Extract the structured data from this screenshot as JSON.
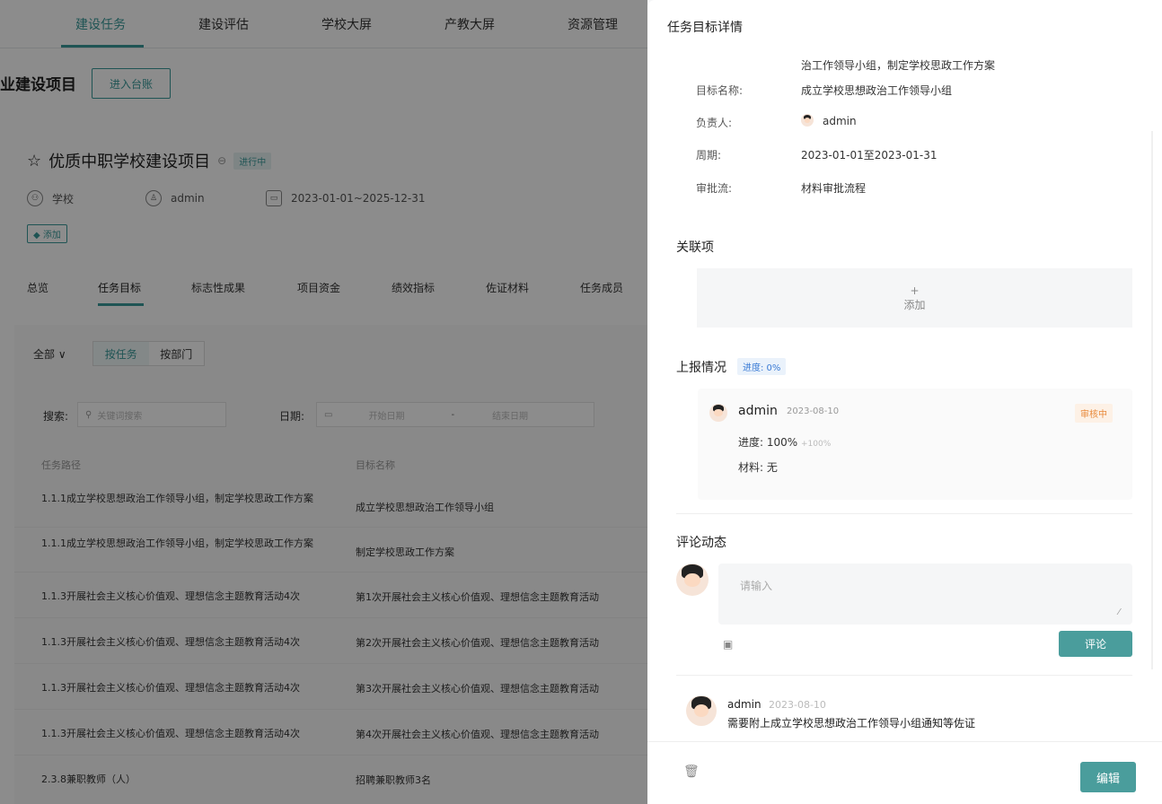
{
  "colors": {
    "accent": "#3a9a9a",
    "button": "#4a9d9c",
    "overlay": "rgba(0,0,0,0.45)",
    "warning": "#e8893a",
    "info": "#3a7bd5"
  },
  "topnav": {
    "items": [
      "建设任务",
      "建设评估",
      "学校大屏",
      "产教大屏",
      "资源管理"
    ],
    "active": "建设任务"
  },
  "project": {
    "page_title": "业建设项目",
    "ledger_button": "进入台账",
    "name": "优质中职学校建设项目",
    "status": "进行中",
    "owner_unit": "学校",
    "owner": "admin",
    "period": "2023-01-01~2025-12-31",
    "tag_add": "添加"
  },
  "tabs": [
    "总览",
    "任务目标",
    "标志性成果",
    "项目资金",
    "绩效指标",
    "佐证材料",
    "任务成员"
  ],
  "filters": {
    "scope": "全部",
    "seg_task": "按任务",
    "seg_dept": "按部门",
    "search_label": "搜索:",
    "search_placeholder": "关键词搜索",
    "date_label": "日期:",
    "date_start": "开始日期",
    "date_sep": "-",
    "date_end": "结束日期"
  },
  "table": {
    "headers": [
      "任务路径",
      "目标名称"
    ],
    "rows": [
      {
        "path": "1.1.1成立学校思想政治工作领导小组，制定学校思政工作方案",
        "target": "成立学校思想政治工作领导小组"
      },
      {
        "path": "1.1.1成立学校思想政治工作领导小组，制定学校思政工作方案",
        "target": "制定学校思政工作方案"
      },
      {
        "path": "1.1.3开展社会主义核心价值观、理想信念主题教育活动4次",
        "target": "第1次开展社会主义核心价值观、理想信念主题教育活动"
      },
      {
        "path": "1.1.3开展社会主义核心价值观、理想信念主题教育活动4次",
        "target": "第2次开展社会主义核心价值观、理想信念主题教育活动"
      },
      {
        "path": "1.1.3开展社会主义核心价值观、理想信念主题教育活动4次",
        "target": "第3次开展社会主义核心价值观、理想信念主题教育活动"
      },
      {
        "path": "1.1.3开展社会主义核心价值观、理想信念主题教育活动4次",
        "target": "第4次开展社会主义核心价值观、理想信念主题教育活动"
      },
      {
        "path": "2.3.8兼职教师（人）",
        "target": "招聘兼职教师3名"
      }
    ]
  },
  "drawer": {
    "title": "任务目标详情",
    "task_path_tail": "治工作领导小组，制定学校思政工作方案",
    "fields": {
      "target_label": "目标名称:",
      "target_value": "成立学校思想政治工作领导小组",
      "owner_label": "负责人:",
      "owner_value": "admin",
      "period_label": "周期:",
      "period_value": "2023-01-01至2023-01-31",
      "flow_label": "审批流:",
      "flow_value": "材料审批流程"
    },
    "assoc": {
      "title": "关联项",
      "plus": "+",
      "add": "添加"
    },
    "report": {
      "title": "上报情况",
      "progress_badge": "进度: 0%",
      "user": "admin",
      "date": "2023-08-10",
      "status": "审核中",
      "progress_label": "进度:",
      "progress_value": "100%",
      "progress_delta": "+100%",
      "material_label": "材料:",
      "material_value": "无"
    },
    "comments": {
      "title": "评论动态",
      "placeholder": "请输入",
      "submit": "评论",
      "items": [
        {
          "user": "admin",
          "date": "2023-08-10",
          "text": "需要附上成立学校思想政治工作领导小组通知等佐证"
        }
      ]
    },
    "edit_button": "编辑"
  }
}
